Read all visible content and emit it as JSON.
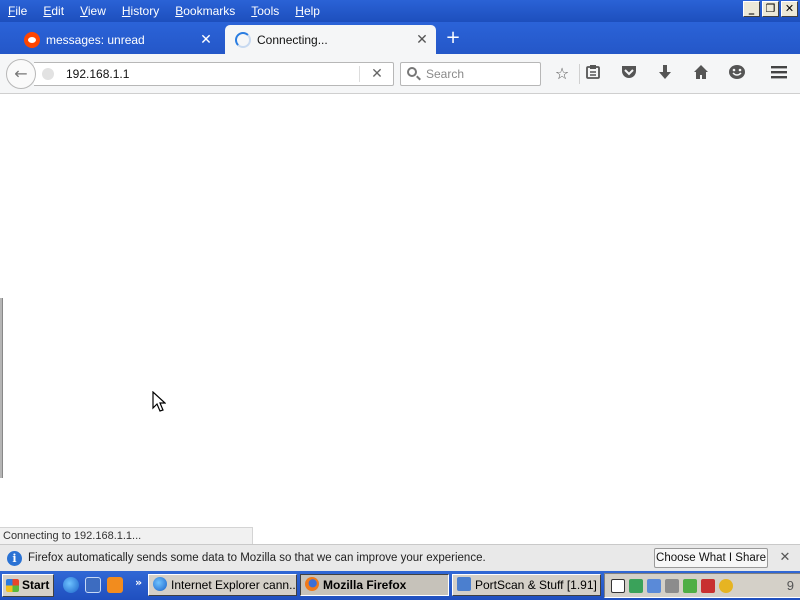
{
  "menu": {
    "items": [
      "File",
      "Edit",
      "View",
      "History",
      "Bookmarks",
      "Tools",
      "Help"
    ]
  },
  "window_controls": {
    "minimize": "_",
    "restore": "❐",
    "close": "✕"
  },
  "tabs": [
    {
      "label": "messages: unread",
      "icon": "reddit-icon",
      "active": false
    },
    {
      "label": "Connecting...",
      "icon": "loading-spinner-icon",
      "active": true
    }
  ],
  "tab_close": "✕",
  "new_tab": "+",
  "navbar": {
    "back": "←",
    "url": "192.168.1.1",
    "stop": "✕",
    "search_placeholder": "Search",
    "icons": [
      "bookmark-star-icon",
      "reading-list-icon",
      "pocket-icon",
      "downloads-icon",
      "home-icon",
      "hello-chat-icon",
      "menu-icon"
    ]
  },
  "status": {
    "text": "Connecting to 192.168.1.1..."
  },
  "notification": {
    "text": "Firefox automatically sends some data to Mozilla so that we can improve your experience.",
    "button": "Choose What I Share",
    "close": "✕"
  },
  "taskbar": {
    "start": "Start",
    "quick_launch_more": "»",
    "buttons": [
      {
        "label": "Internet Explorer cann...",
        "active": false
      },
      {
        "label": "Mozilla Firefox",
        "active": true
      },
      {
        "label": "PortScan & Stuff [1.91]",
        "active": false
      }
    ],
    "clock": "9"
  },
  "colors": {
    "titlebar": "#1d4fbd",
    "active_tab": "#f5f6f7",
    "taskbar": "#2457c8",
    "info_accent": "#2a72d4"
  }
}
